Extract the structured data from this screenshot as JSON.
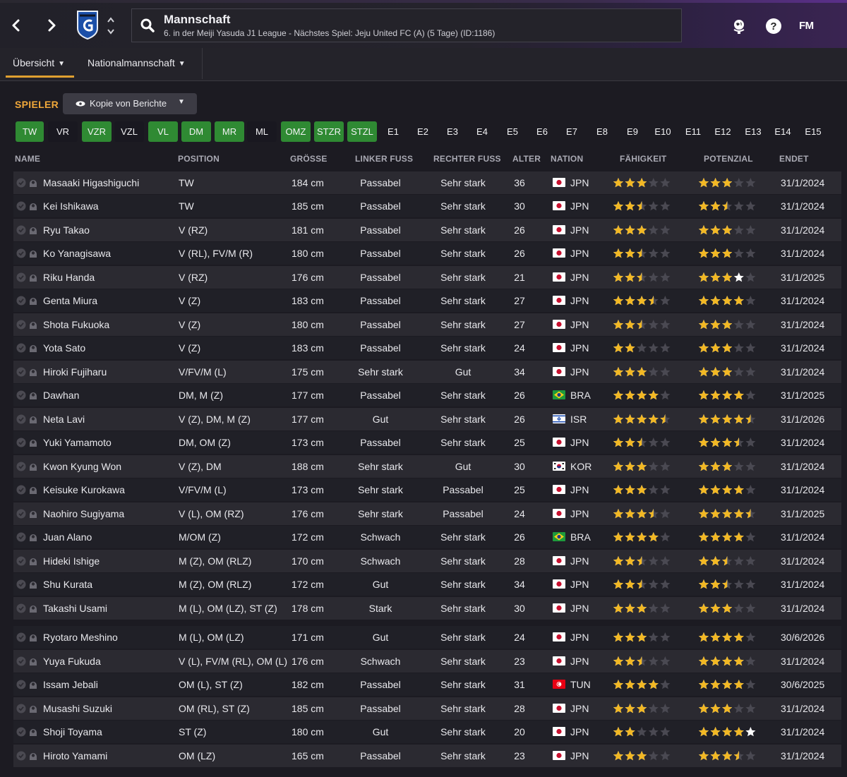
{
  "header": {
    "title": "Mannschaft",
    "subtitle": "6. in der Meiji Yasuda J1 League - Nächstes Spiel: Jeju United FC (A) (5 Tage) (ID:1186)",
    "back_label": "‹",
    "forward_label": "›",
    "logo_text": "FM"
  },
  "subnav": {
    "tabs": [
      {
        "label": "Übersicht",
        "active": true
      },
      {
        "label": "Nationalmannschaft",
        "active": false
      }
    ]
  },
  "section": {
    "title": "SPIELER",
    "view_label": "Kopie von Berichte"
  },
  "filters": [
    {
      "label": "TW",
      "state": "on"
    },
    {
      "label": "VR",
      "state": "off"
    },
    {
      "label": "VZR",
      "state": "on"
    },
    {
      "label": "VZL",
      "state": "off"
    },
    {
      "label": "VL",
      "state": "on"
    },
    {
      "label": "DM",
      "state": "on"
    },
    {
      "label": "MR",
      "state": "on"
    },
    {
      "label": "ML",
      "state": "off"
    },
    {
      "label": "OMZ",
      "state": "on"
    },
    {
      "label": "STZR",
      "state": "on"
    },
    {
      "label": "STZL",
      "state": "on"
    },
    {
      "label": "E1",
      "state": "plain"
    },
    {
      "label": "E2",
      "state": "plain"
    },
    {
      "label": "E3",
      "state": "plain"
    },
    {
      "label": "E4",
      "state": "plain"
    },
    {
      "label": "E5",
      "state": "plain"
    },
    {
      "label": "E6",
      "state": "plain"
    },
    {
      "label": "E7",
      "state": "plain"
    },
    {
      "label": "E8",
      "state": "plain"
    },
    {
      "label": "E9",
      "state": "plain"
    },
    {
      "label": "E10",
      "state": "plain"
    },
    {
      "label": "E11",
      "state": "plain"
    },
    {
      "label": "E12",
      "state": "plain"
    },
    {
      "label": "E13",
      "state": "plain"
    },
    {
      "label": "E14",
      "state": "plain"
    },
    {
      "label": "E15",
      "state": "plain"
    }
  ],
  "table": {
    "columns": {
      "name": "NAME",
      "position": "POSITION",
      "height": "GRÖSSE",
      "left_foot": "LINKER FUSS",
      "right_foot": "RECHTER FUSS",
      "age": "ALTER",
      "nation": "NATION",
      "ability": "FÄHIGKEIT",
      "potential": "POTENZIAL",
      "contract_end": "ENDET"
    },
    "rows": [
      {
        "name": "Masaaki Higashiguchi",
        "position": "TW",
        "height": "184 cm",
        "left_foot": "Passabel",
        "right_foot": "Sehr stark",
        "age": "36",
        "nation": "JPN",
        "flag": "jpn",
        "ability": 3,
        "potential": 3,
        "potential_max": 3,
        "ends": "31/1/2024"
      },
      {
        "name": "Kei Ishikawa",
        "position": "TW",
        "height": "185 cm",
        "left_foot": "Passabel",
        "right_foot": "Sehr stark",
        "age": "30",
        "nation": "JPN",
        "flag": "jpn",
        "ability": 2.5,
        "potential": 2.5,
        "potential_max": 2.5,
        "ends": "31/1/2024"
      },
      {
        "name": "Ryu Takao",
        "position": "V (RZ)",
        "height": "181 cm",
        "left_foot": "Passabel",
        "right_foot": "Sehr stark",
        "age": "26",
        "nation": "JPN",
        "flag": "jpn",
        "ability": 3,
        "potential": 3,
        "potential_max": 3,
        "ends": "31/1/2024"
      },
      {
        "name": "Ko Yanagisawa",
        "position": "V (RL), FV/M (R)",
        "height": "180 cm",
        "left_foot": "Passabel",
        "right_foot": "Sehr stark",
        "age": "26",
        "nation": "JPN",
        "flag": "jpn",
        "ability": 2.5,
        "potential": 3,
        "potential_max": 3,
        "ends": "31/1/2024"
      },
      {
        "name": "Riku Handa",
        "position": "V (RZ)",
        "height": "176 cm",
        "left_foot": "Passabel",
        "right_foot": "Sehr stark",
        "age": "21",
        "nation": "JPN",
        "flag": "jpn",
        "ability": 2.5,
        "potential": 3,
        "potential_max": 4,
        "ends": "31/1/2025"
      },
      {
        "name": "Genta Miura",
        "position": "V (Z)",
        "height": "183 cm",
        "left_foot": "Passabel",
        "right_foot": "Sehr stark",
        "age": "27",
        "nation": "JPN",
        "flag": "jpn",
        "ability": 3.5,
        "potential": 4,
        "potential_max": 4,
        "ends": "31/1/2024"
      },
      {
        "name": "Shota Fukuoka",
        "position": "V (Z)",
        "height": "180 cm",
        "left_foot": "Passabel",
        "right_foot": "Sehr stark",
        "age": "27",
        "nation": "JPN",
        "flag": "jpn",
        "ability": 2.5,
        "potential": 3,
        "potential_max": 3,
        "ends": "31/1/2024"
      },
      {
        "name": "Yota Sato",
        "position": "V (Z)",
        "height": "183 cm",
        "left_foot": "Passabel",
        "right_foot": "Sehr stark",
        "age": "24",
        "nation": "JPN",
        "flag": "jpn",
        "ability": 2,
        "potential": 3,
        "potential_max": 3,
        "ends": "31/1/2024"
      },
      {
        "name": "Hiroki Fujiharu",
        "position": "V/FV/M (L)",
        "height": "175 cm",
        "left_foot": "Sehr stark",
        "right_foot": "Gut",
        "age": "34",
        "nation": "JPN",
        "flag": "jpn",
        "ability": 3,
        "potential": 3,
        "potential_max": 3,
        "ends": "31/1/2024"
      },
      {
        "name": "Dawhan",
        "position": "DM, M (Z)",
        "height": "177 cm",
        "left_foot": "Passabel",
        "right_foot": "Sehr stark",
        "age": "26",
        "nation": "BRA",
        "flag": "bra",
        "ability": 4,
        "potential": 4,
        "potential_max": 4,
        "ends": "31/1/2025"
      },
      {
        "name": "Neta Lavi",
        "position": "V (Z), DM, M (Z)",
        "height": "177 cm",
        "left_foot": "Gut",
        "right_foot": "Sehr stark",
        "age": "26",
        "nation": "ISR",
        "flag": "isr",
        "ability": 4.5,
        "potential": 4.5,
        "potential_max": 4.5,
        "ends": "31/1/2026"
      },
      {
        "name": "Yuki Yamamoto",
        "position": "DM, OM (Z)",
        "height": "173 cm",
        "left_foot": "Passabel",
        "right_foot": "Sehr stark",
        "age": "25",
        "nation": "JPN",
        "flag": "jpn",
        "ability": 2.5,
        "potential": 3.5,
        "potential_max": 3.5,
        "ends": "31/1/2024"
      },
      {
        "name": "Kwon Kyung Won",
        "position": "V (Z), DM",
        "height": "188 cm",
        "left_foot": "Sehr stark",
        "right_foot": "Gut",
        "age": "30",
        "nation": "KOR",
        "flag": "kor",
        "ability": 3,
        "potential": 3,
        "potential_max": 3,
        "ends": "31/1/2024"
      },
      {
        "name": "Keisuke Kurokawa",
        "position": "V/FV/M (L)",
        "height": "173 cm",
        "left_foot": "Sehr stark",
        "right_foot": "Passabel",
        "age": "25",
        "nation": "JPN",
        "flag": "jpn",
        "ability": 3,
        "potential": 4,
        "potential_max": 4,
        "ends": "31/1/2024"
      },
      {
        "name": "Naohiro Sugiyama",
        "position": "V (L), OM (RZ)",
        "height": "176 cm",
        "left_foot": "Sehr stark",
        "right_foot": "Passabel",
        "age": "24",
        "nation": "JPN",
        "flag": "jpn",
        "ability": 3.5,
        "potential": 4.5,
        "potential_max": 4.5,
        "ends": "31/1/2025"
      },
      {
        "name": "Juan Alano",
        "position": "M/OM (Z)",
        "height": "172 cm",
        "left_foot": "Schwach",
        "right_foot": "Sehr stark",
        "age": "26",
        "nation": "BRA",
        "flag": "bra",
        "ability": 4,
        "potential": 4,
        "potential_max": 4,
        "ends": "31/1/2024"
      },
      {
        "name": "Hideki Ishige",
        "position": "M (Z), OM (RLZ)",
        "height": "170 cm",
        "left_foot": "Schwach",
        "right_foot": "Sehr stark",
        "age": "28",
        "nation": "JPN",
        "flag": "jpn",
        "ability": 2.5,
        "potential": 2.5,
        "potential_max": 2.5,
        "ends": "31/1/2024"
      },
      {
        "name": "Shu Kurata",
        "position": "M (Z), OM (RLZ)",
        "height": "172 cm",
        "left_foot": "Gut",
        "right_foot": "Sehr stark",
        "age": "34",
        "nation": "JPN",
        "flag": "jpn",
        "ability": 2.5,
        "potential": 2.5,
        "potential_max": 2.5,
        "ends": "31/1/2024"
      },
      {
        "name": "Takashi Usami",
        "position": "M (L), OM (LZ), ST (Z)",
        "height": "178 cm",
        "left_foot": "Stark",
        "right_foot": "Sehr stark",
        "age": "30",
        "nation": "JPN",
        "flag": "jpn",
        "ability": 3,
        "potential": 3,
        "potential_max": 3,
        "ends": "31/1/2024"
      },
      {
        "name": "Ryotaro Meshino",
        "position": "M (L), OM (LZ)",
        "height": "171 cm",
        "left_foot": "Gut",
        "right_foot": "Sehr stark",
        "age": "24",
        "nation": "JPN",
        "flag": "jpn",
        "ability": 3,
        "potential": 4,
        "potential_max": 4,
        "ends": "30/6/2026"
      },
      {
        "name": "Yuya Fukuda",
        "position": "V (L), FV/M (RL), OM (L)",
        "height": "176 cm",
        "left_foot": "Schwach",
        "right_foot": "Sehr stark",
        "age": "23",
        "nation": "JPN",
        "flag": "jpn",
        "ability": 2.5,
        "potential": 4,
        "potential_max": 4,
        "ends": "31/1/2024"
      },
      {
        "name": "Issam Jebali",
        "position": "OM (L), ST (Z)",
        "height": "182 cm",
        "left_foot": "Passabel",
        "right_foot": "Sehr stark",
        "age": "31",
        "nation": "TUN",
        "flag": "tun",
        "ability": 4,
        "potential": 4,
        "potential_max": 4,
        "ends": "30/6/2025"
      },
      {
        "name": "Musashi Suzuki",
        "position": "OM (RL), ST (Z)",
        "height": "185 cm",
        "left_foot": "Passabel",
        "right_foot": "Sehr stark",
        "age": "28",
        "nation": "JPN",
        "flag": "jpn",
        "ability": 3,
        "potential": 3,
        "potential_max": 3,
        "ends": "31/1/2024"
      },
      {
        "name": "Shoji Toyama",
        "position": "ST (Z)",
        "height": "180 cm",
        "left_foot": "Gut",
        "right_foot": "Sehr stark",
        "age": "20",
        "nation": "JPN",
        "flag": "jpn",
        "ability": 2,
        "potential": 4,
        "potential_max": 5,
        "ends": "31/1/2024"
      },
      {
        "name": "Hiroto Yamami",
        "position": "OM (LZ)",
        "height": "165 cm",
        "left_foot": "Passabel",
        "right_foot": "Sehr stark",
        "age": "23",
        "nation": "JPN",
        "flag": "jpn",
        "ability": 3,
        "potential": 3.5,
        "potential_max": 3.5,
        "ends": "31/1/2024"
      }
    ]
  },
  "colors": {
    "accent": "#f1a83a",
    "chip_on": "#2f8a33",
    "star_filled": "#f2b824",
    "star_empty": "#4a4952",
    "star_potential": "#ffffff"
  }
}
